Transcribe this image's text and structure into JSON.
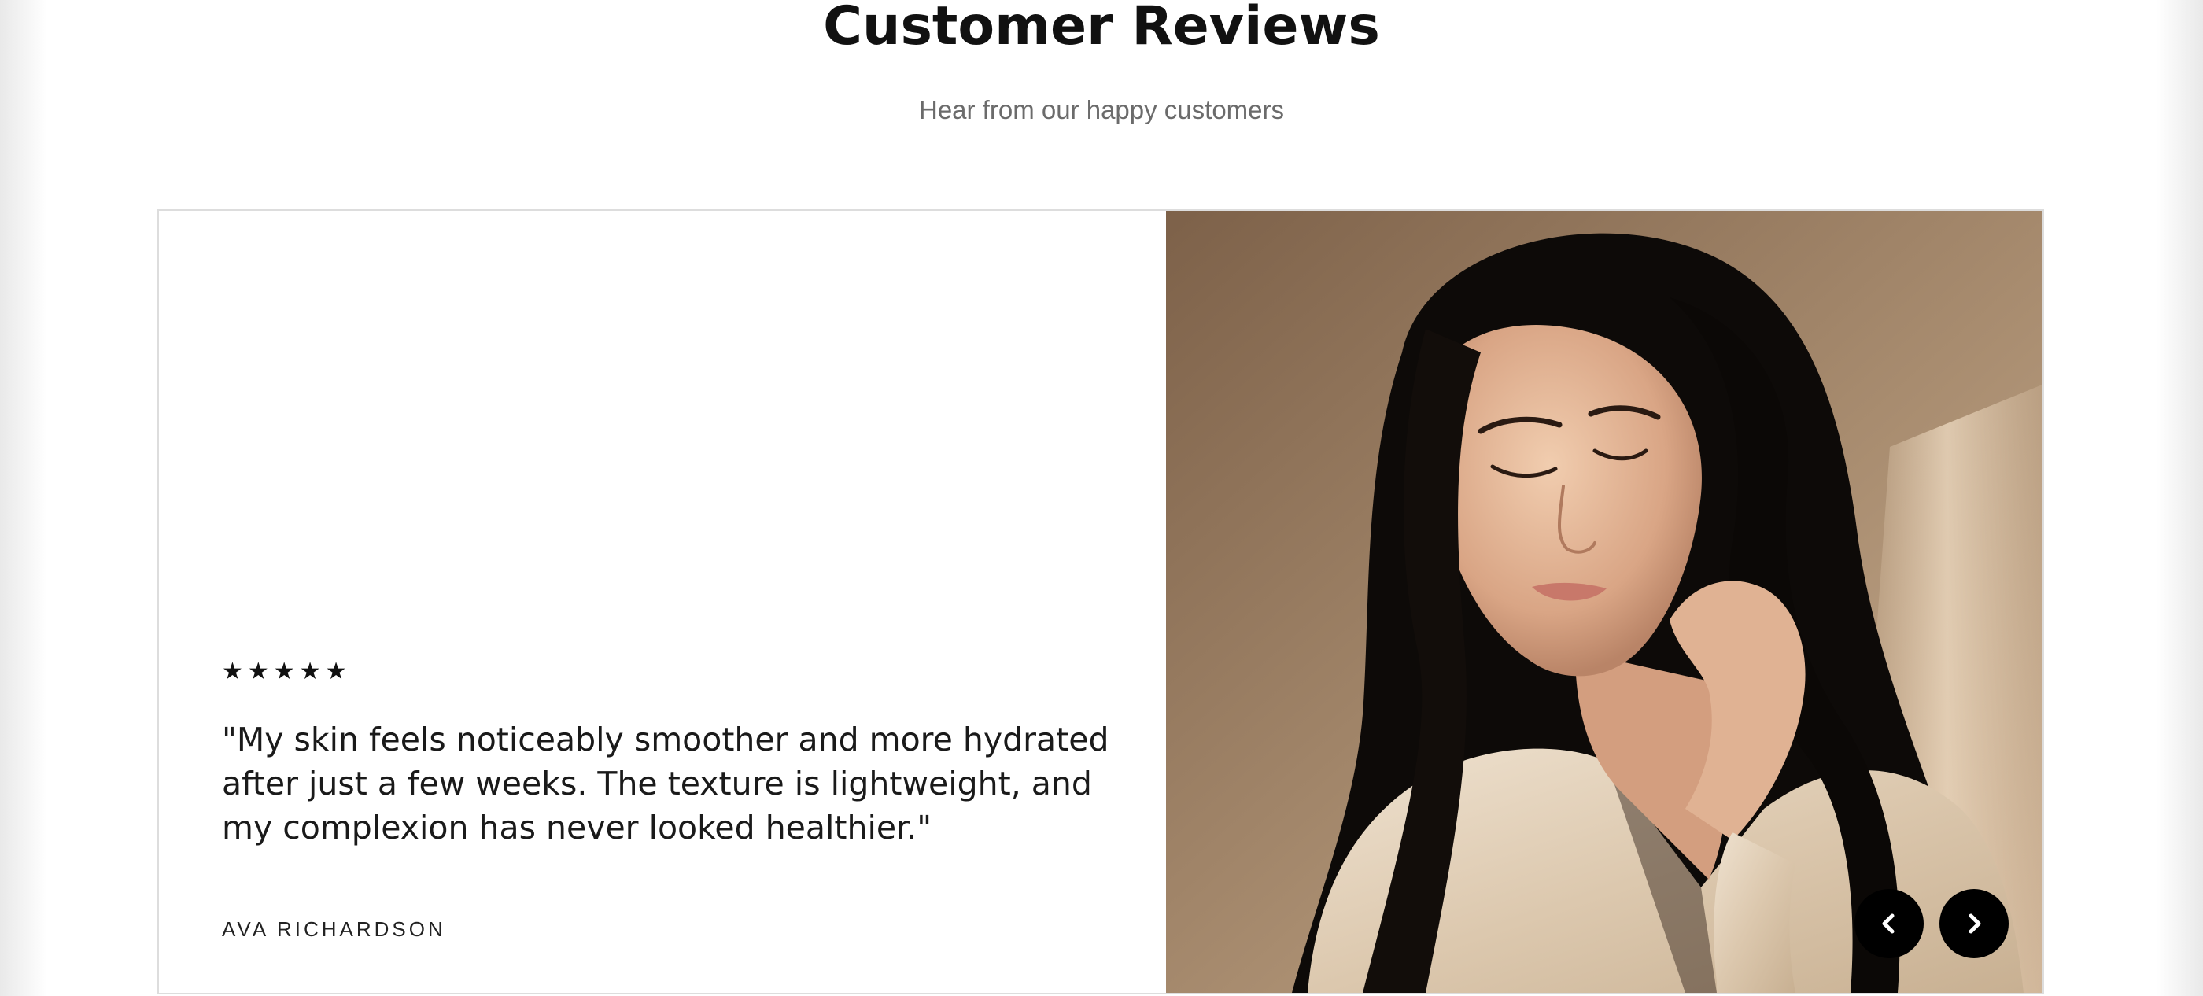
{
  "section": {
    "title": "Customer Reviews",
    "subtitle": "Hear from our happy customers"
  },
  "review": {
    "stars": "★★★★★",
    "rating": 5,
    "rating_max": 5,
    "quote": "\"My skin feels noticeably smoother and more hydrated after just a few weeks. The texture is lightweight, and my complexion has never looked healthier.\"",
    "reviewer": "AVA RICHARDSON",
    "photo_alt": "woman-with-long-dark-hair-touching-neck"
  },
  "carousel": {
    "prev_icon": "chevron-left-icon",
    "next_icon": "chevron-right-icon",
    "button_color": "#000000"
  },
  "colors": {
    "title": "#111111",
    "subtitle": "#6b6b6b",
    "card_border": "#dddddd",
    "background": "#ffffff"
  }
}
